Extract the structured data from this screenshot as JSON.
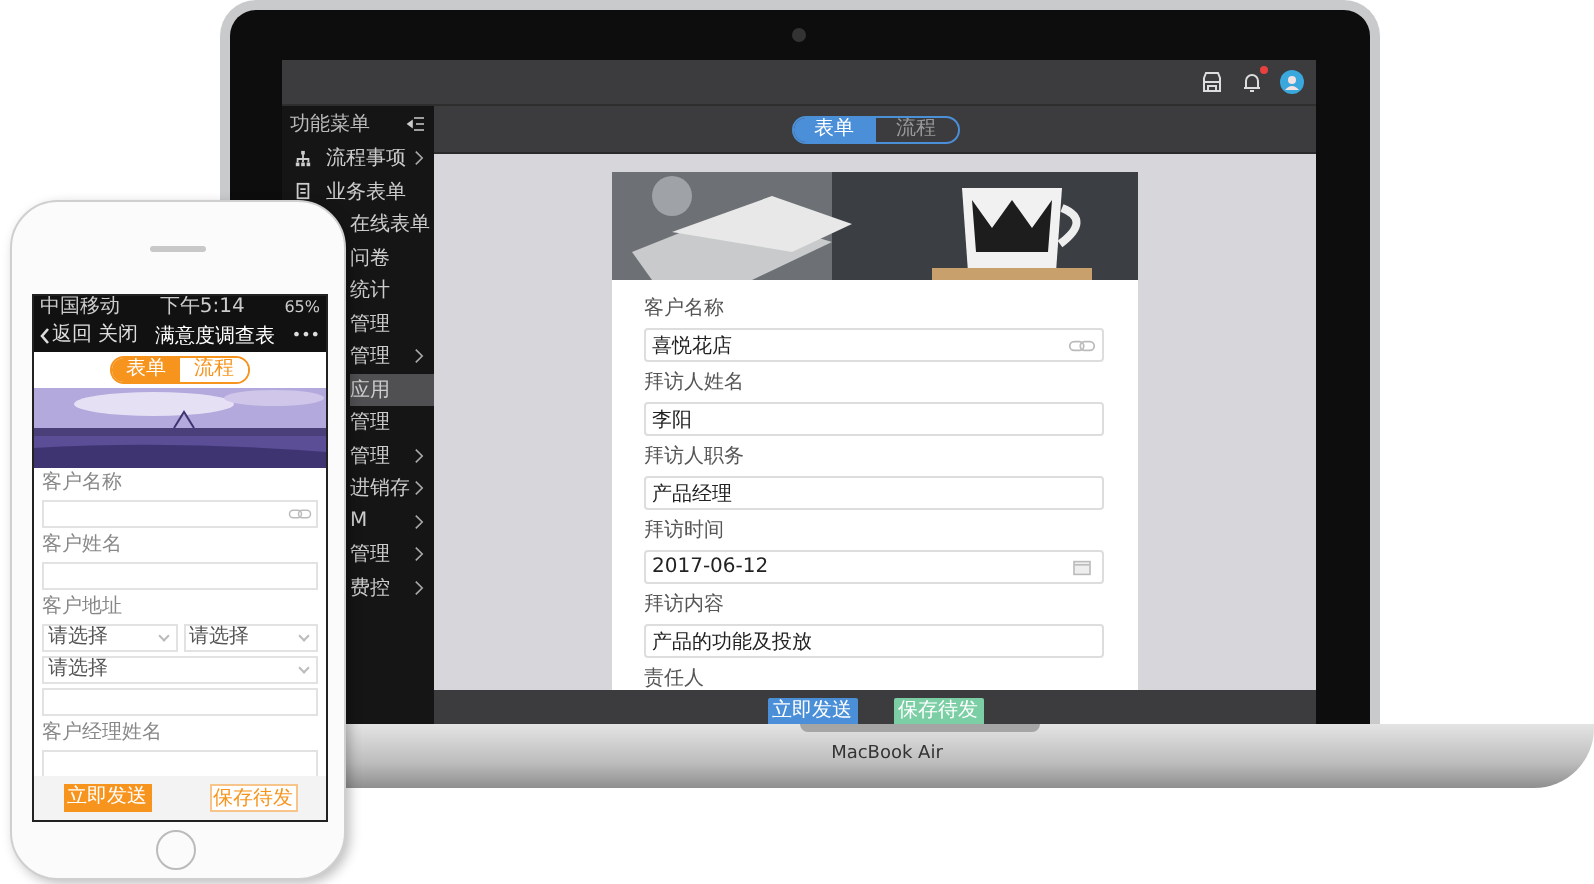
{
  "laptop": {
    "top_bar": {
      "notification": true
    },
    "sidebar": {
      "title": "功能菜单",
      "items": [
        {
          "label": "流程事项",
          "kind": "with_icon",
          "expandable": true,
          "selected": false
        },
        {
          "label": "业务表单",
          "kind": "with_icon",
          "expandable": false,
          "selected": false
        },
        {
          "label": "在线表单",
          "kind": "plain",
          "expandable": false,
          "selected": false
        },
        {
          "label": "问卷",
          "kind": "plain",
          "expandable": false,
          "selected": false
        },
        {
          "label": "统计",
          "kind": "plain",
          "expandable": false,
          "selected": false
        },
        {
          "label": "管理",
          "kind": "plain",
          "expandable": false,
          "selected": false
        },
        {
          "label": "管理",
          "kind": "plain",
          "expandable": true,
          "selected": false
        },
        {
          "label": "应用",
          "kind": "plain",
          "expandable": false,
          "selected": true
        },
        {
          "label": "管理",
          "kind": "plain",
          "expandable": false,
          "selected": false
        },
        {
          "label": "管理",
          "kind": "plain",
          "expandable": true,
          "selected": false
        },
        {
          "label": "进销存",
          "kind": "plain",
          "expandable": true,
          "selected": false
        },
        {
          "label": "M",
          "kind": "plain",
          "expandable": true,
          "selected": false
        },
        {
          "label": "管理",
          "kind": "plain",
          "expandable": true,
          "selected": false
        },
        {
          "label": "费控",
          "kind": "plain",
          "expandable": true,
          "selected": false
        }
      ]
    },
    "tabs": [
      {
        "label": "表单",
        "selected": true
      },
      {
        "label": "流程",
        "selected": false
      }
    ],
    "form": {
      "fields": [
        {
          "label": "客户名称",
          "value": "喜悦花店",
          "kind": "link"
        },
        {
          "label": "拜访人姓名",
          "value": "李阳",
          "kind": "text"
        },
        {
          "label": "拜访人职务",
          "value": "产品经理",
          "kind": "text"
        },
        {
          "label": "拜访时间",
          "value": "2017-06-12",
          "kind": "date"
        },
        {
          "label": "拜访内容",
          "value": "产品的功能及投放",
          "kind": "text"
        }
      ],
      "last_label": "责任人"
    },
    "buttons": [
      {
        "label": "立即发送",
        "kind": "primary"
      },
      {
        "label": "保存待发",
        "kind": "secondary"
      }
    ],
    "brand": "MacBook Air"
  },
  "phone": {
    "status_bar": {
      "carrier": "中国移动",
      "time": "下午5:14",
      "battery": "65%"
    },
    "nav": {
      "back": "返回",
      "close": "关闭",
      "title": "满意度调查表",
      "more": "•••"
    },
    "tabs": [
      {
        "label": "表单",
        "selected": true
      },
      {
        "label": "流程",
        "selected": false
      }
    ],
    "fields": [
      {
        "label": "客户名称",
        "kind": "link"
      },
      {
        "label": "客户姓名",
        "kind": "text"
      },
      {
        "label": "客户地址",
        "kind": "address",
        "selects": [
          "请选择",
          "请选择",
          "请选择"
        ]
      },
      {
        "label": "客户经理姓名",
        "kind": "text"
      }
    ],
    "buttons": [
      {
        "label": "立即发送",
        "kind": "primary"
      },
      {
        "label": "保存待发",
        "kind": "secondary"
      }
    ]
  }
}
